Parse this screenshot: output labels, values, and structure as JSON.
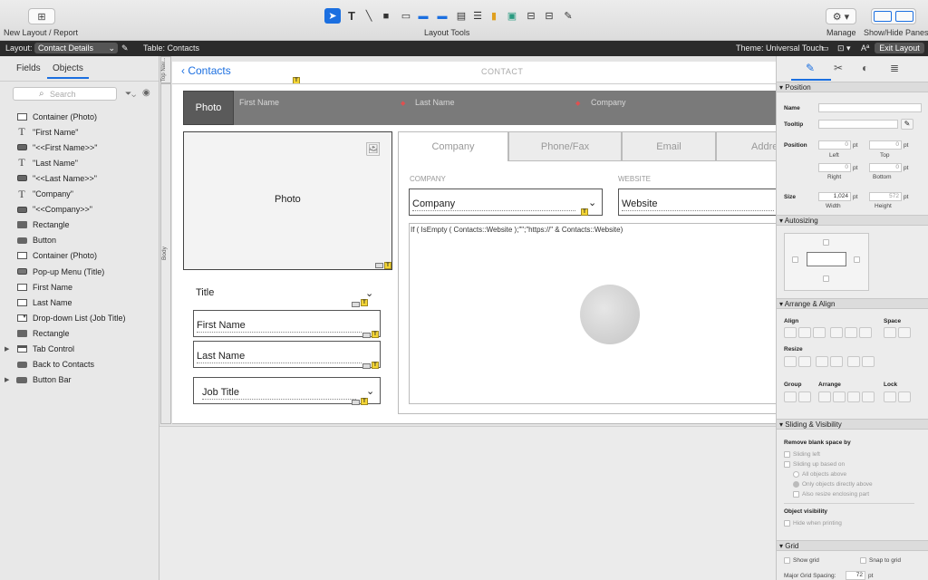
{
  "toolbar": {
    "new_layout_label": "New Layout / Report",
    "layout_tools_label": "Layout Tools",
    "manage_label": "Manage",
    "show_hide_label": "Show/Hide Panes"
  },
  "layoutbar": {
    "layout_label": "Layout:",
    "layout_value": "Contact Details",
    "table_label": "Table: Contacts",
    "theme_label": "Theme: Universal Touch",
    "exit_label": "Exit Layout",
    "font_icon": "Aª"
  },
  "left_pane": {
    "tabs": [
      "Fields",
      "Objects"
    ],
    "search_placeholder": "Search",
    "objects": [
      {
        "icon": "container",
        "label": "Container (Photo)"
      },
      {
        "icon": "text",
        "label": "\"First Name\""
      },
      {
        "icon": "field",
        "label": "\"<<First Name>>\""
      },
      {
        "icon": "text",
        "label": "\"Last Name\""
      },
      {
        "icon": "field",
        "label": "\"<<Last Name>>\""
      },
      {
        "icon": "text",
        "label": "\"Company\""
      },
      {
        "icon": "field",
        "label": "\"<<Company>>\""
      },
      {
        "icon": "rect",
        "label": "Rectangle"
      },
      {
        "icon": "button",
        "label": "Button"
      },
      {
        "icon": "container",
        "label": "Container (Photo)"
      },
      {
        "icon": "popup",
        "label": "Pop-up Menu (Title)"
      },
      {
        "icon": "frame",
        "label": "First Name"
      },
      {
        "icon": "frame",
        "label": "Last Name"
      },
      {
        "icon": "dropdown",
        "label": "Drop-down List (Job Title)"
      },
      {
        "icon": "rect",
        "label": "Rectangle"
      },
      {
        "icon": "tab",
        "label": "Tab Control",
        "expandable": true
      },
      {
        "icon": "button",
        "label": "Back to Contacts"
      },
      {
        "icon": "buttonbar",
        "label": "Button Bar",
        "expandable": true
      }
    ]
  },
  "canvas": {
    "part_top": "Top Nav...",
    "part_body": "Body",
    "back_label": "Contacts",
    "header_title": "CONTACT",
    "photo_tab": "Photo",
    "header_fields": [
      "First Name",
      "Last Name",
      "Company"
    ],
    "photo_container_label": "Photo",
    "title_label": "Title",
    "first_name": "First Name",
    "last_name": "Last Name",
    "job_title": "Job Title",
    "tabs": [
      "Company",
      "Phone/Fax",
      "Email",
      "Addre"
    ],
    "company_caption": "COMPANY",
    "website_caption": "WEBSITE",
    "company_field": "Company",
    "website_field": "Website",
    "calc_text": "If ( IsEmpty ( Contacts::Website );\"\";\"https://\" & Contacts::Website)",
    "badge": "T"
  },
  "right_pane": {
    "sections": {
      "position": "Position",
      "autosizing": "Autosizing",
      "arrange": "Arrange & Align",
      "sliding": "Sliding & Visibility",
      "grid": "Grid"
    },
    "name_label": "Name",
    "tooltip_label": "Tooltip",
    "position_label": "Position",
    "size_label": "Size",
    "pos_values": [
      "0",
      "0",
      "0",
      "0"
    ],
    "pos_unit": "pt",
    "sub_left": "Left",
    "sub_top": "Top",
    "sub_right": "Right",
    "sub_bottom": "Bottom",
    "width_value": "1,024",
    "height_value": "572",
    "sub_width": "Width",
    "sub_height": "Height",
    "align_label": "Align",
    "space_label": "Space",
    "resize_label": "Resize",
    "group_label": "Group",
    "arrange_label": "Arrange",
    "lock_label": "Lock",
    "remove_blank": "Remove blank space by",
    "sliding_left": "Sliding left",
    "sliding_up": "Sliding up based on",
    "all_objects_above": "All objects above",
    "only_directly_above": "Only objects directly above",
    "also_resize": "Also resize enclosing part",
    "object_visibility": "Object visibility",
    "hide_when_printing": "Hide when printing",
    "show_grid": "Show grid",
    "snap_to_grid": "Snap to grid",
    "major_grid_label": "Major Grid Spacing:",
    "major_grid_value": "72",
    "major_grid_unit": "pt"
  },
  "colors": {
    "accent": "#1b6fe0",
    "dark_bar": "#2b2b2b",
    "header_bar": "#7a7a7a",
    "badge": "#f4d535"
  }
}
